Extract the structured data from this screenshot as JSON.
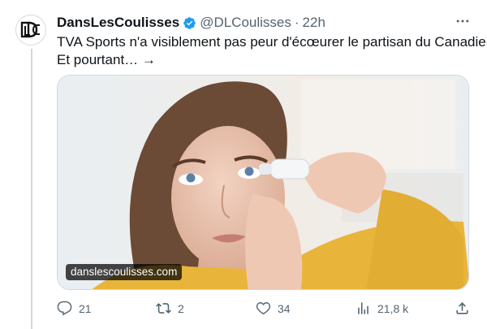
{
  "author": {
    "display_name": "DansLesCoulisses",
    "handle": "@DLCoulisses",
    "separator": "·",
    "time": "22h",
    "verified": true,
    "avatar_icon": "dlc-logo-icon"
  },
  "tweet": {
    "text_line1": "TVA Sports n'a visiblement pas peur d'écœurer le partisan du Canadien.",
    "text_line2": "Et pourtant… →"
  },
  "media": {
    "description_icon": "photo-woman-eye-drops",
    "link_label": "danslescoulisses.com"
  },
  "actions": {
    "reply": {
      "icon": "reply-icon",
      "count": "21"
    },
    "retweet": {
      "icon": "retweet-icon",
      "count": "2"
    },
    "like": {
      "icon": "heart-icon",
      "count": "34"
    },
    "views": {
      "icon": "views-icon",
      "count": "21,8 k"
    },
    "share": {
      "icon": "share-icon"
    }
  },
  "colors": {
    "text": "#0f1419",
    "secondary": "#536471",
    "verified": "#1d9bf0",
    "border": "#cfd9de",
    "sweater": "#e8b53a"
  }
}
